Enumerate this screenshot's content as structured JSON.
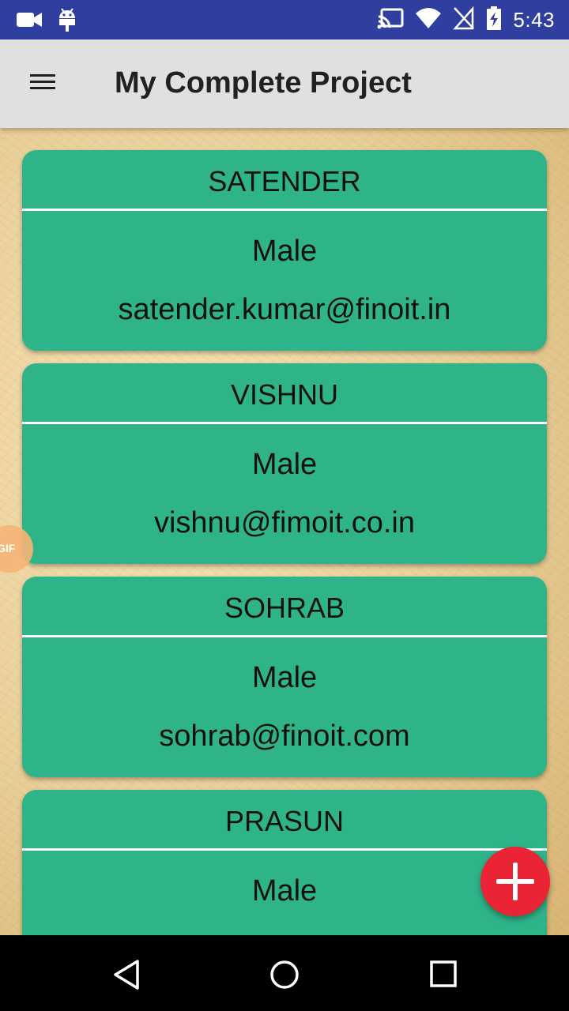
{
  "status_bar": {
    "time": "5:43",
    "icons": [
      "video-camera-icon",
      "android-icon",
      "cast-icon",
      "wifi-icon",
      "no-sim-icon",
      "battery-charging-icon"
    ]
  },
  "app_bar": {
    "title": "My Complete Project",
    "menu_icon": "hamburger-menu-icon"
  },
  "users": [
    {
      "name": "SATENDER",
      "gender": "Male",
      "email": "satender.kumar@finoit.in"
    },
    {
      "name": "VISHNU",
      "gender": "Male",
      "email": "vishnu@fimoit.co.in"
    },
    {
      "name": "SOHRAB",
      "gender": "Male",
      "email": "sohrab@finoit.com"
    },
    {
      "name": "PRASUN",
      "gender": "Male",
      "email": ""
    }
  ],
  "overlay": {
    "gif_label": "GIF"
  },
  "fab": {
    "icon": "plus-icon",
    "color": "#ea2435"
  },
  "colors": {
    "status_bar": "#303f9f",
    "app_bar": "#e0e0e0",
    "card": "#2fb48a"
  },
  "nav_bar": {
    "icons": [
      "back-icon",
      "home-icon",
      "recents-icon"
    ]
  }
}
